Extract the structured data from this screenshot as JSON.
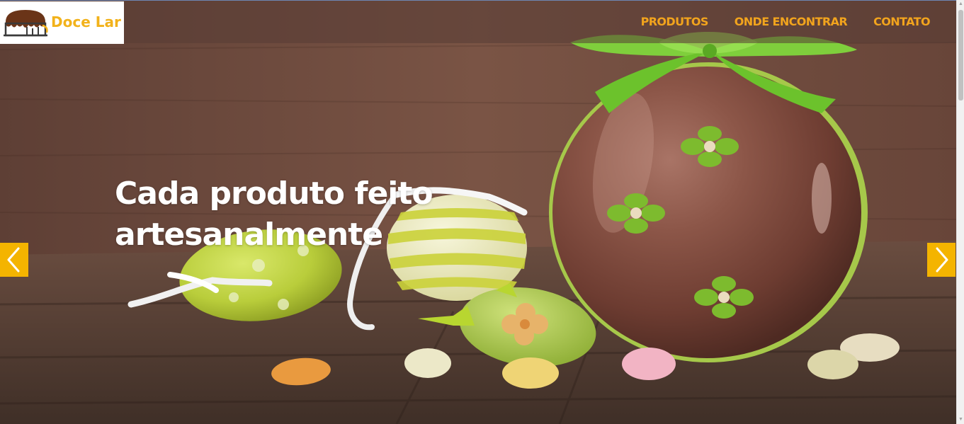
{
  "brand": {
    "name": "Doce Lar",
    "logo_icon": "cake-icon",
    "accent_color": "#f2b21b"
  },
  "nav": {
    "items": [
      {
        "label": "PRODUTOS"
      },
      {
        "label": "ONDE ENCONTRAR"
      },
      {
        "label": "CONTATO"
      }
    ],
    "link_color": "#f2a41d"
  },
  "hero": {
    "headline": "Cada produto feito artesanalmente",
    "image": "easter-eggs-photo"
  },
  "carousel": {
    "prev_icon": "chevron-left-icon",
    "next_icon": "chevron-right-icon",
    "button_color": "#f4b400"
  }
}
